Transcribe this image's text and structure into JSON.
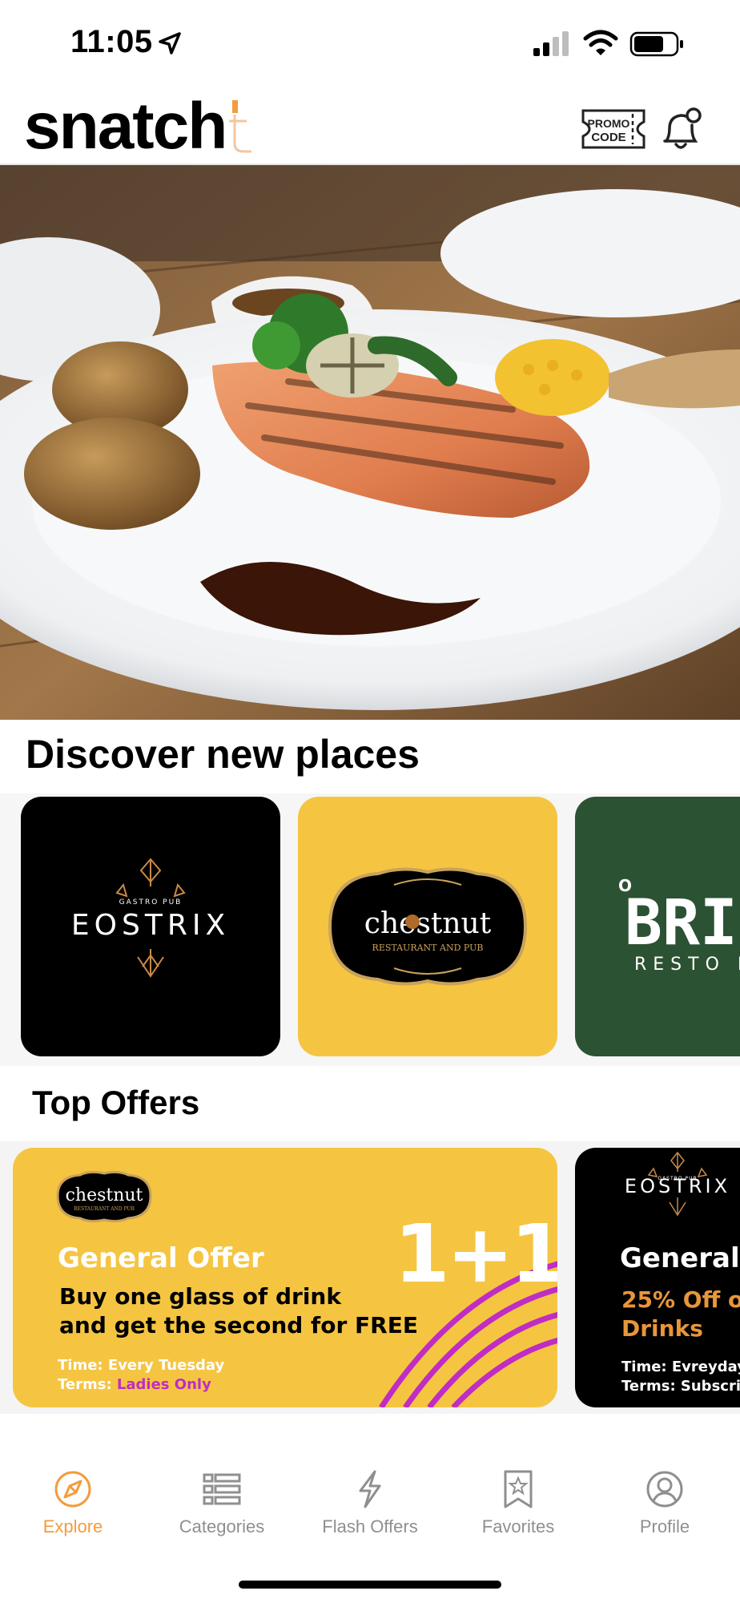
{
  "status": {
    "time": "11:05"
  },
  "header": {
    "logo": "snatch",
    "logo_accent": "t",
    "promo_line1": "PROMO",
    "promo_line2": "CODE"
  },
  "discover": {
    "title": "Discover new places",
    "places": [
      {
        "name": "EOSTRIX",
        "tagline": "GASTRO PUB"
      },
      {
        "name": "chestnut",
        "tagline": "RESTAURANT AND PUB"
      },
      {
        "name": "BRI",
        "tagline": "RESTO F",
        "prefix": "O"
      }
    ]
  },
  "top_offers": {
    "title": "Top Offers",
    "offers": [
      {
        "brand": "chestnut",
        "brand_tagline": "RESTAURANT AND PUB",
        "badge": "1+1",
        "type": "General Offer",
        "desc_line1": "Buy one glass of drink",
        "desc_line2": "and get the second for FREE",
        "time": "Time: Every Tuesday",
        "terms_label": "Terms: ",
        "terms_value": "Ladies Only"
      },
      {
        "brand": "EOSTRIX",
        "brand_tagline": "GASTRO PUB",
        "type": "General",
        "desc_line1": "25% Off o",
        "desc_line2": "Drinks",
        "time": "Time: Evreyday",
        "terms": "Terms: Subscri"
      }
    ]
  },
  "tabs": [
    {
      "label": "Explore",
      "icon": "compass-icon",
      "active": true
    },
    {
      "label": "Categories",
      "icon": "list-icon"
    },
    {
      "label": "Flash Offers",
      "icon": "lightning-icon"
    },
    {
      "label": "Favorites",
      "icon": "bookmark-star-icon"
    },
    {
      "label": "Profile",
      "icon": "user-icon"
    }
  ],
  "colors": {
    "accent": "#f39c3d",
    "card_yellow": "#f5c542",
    "card_green": "#2c5234",
    "terms_pink": "#c02cc4",
    "drinks_orange": "#e8963a"
  }
}
